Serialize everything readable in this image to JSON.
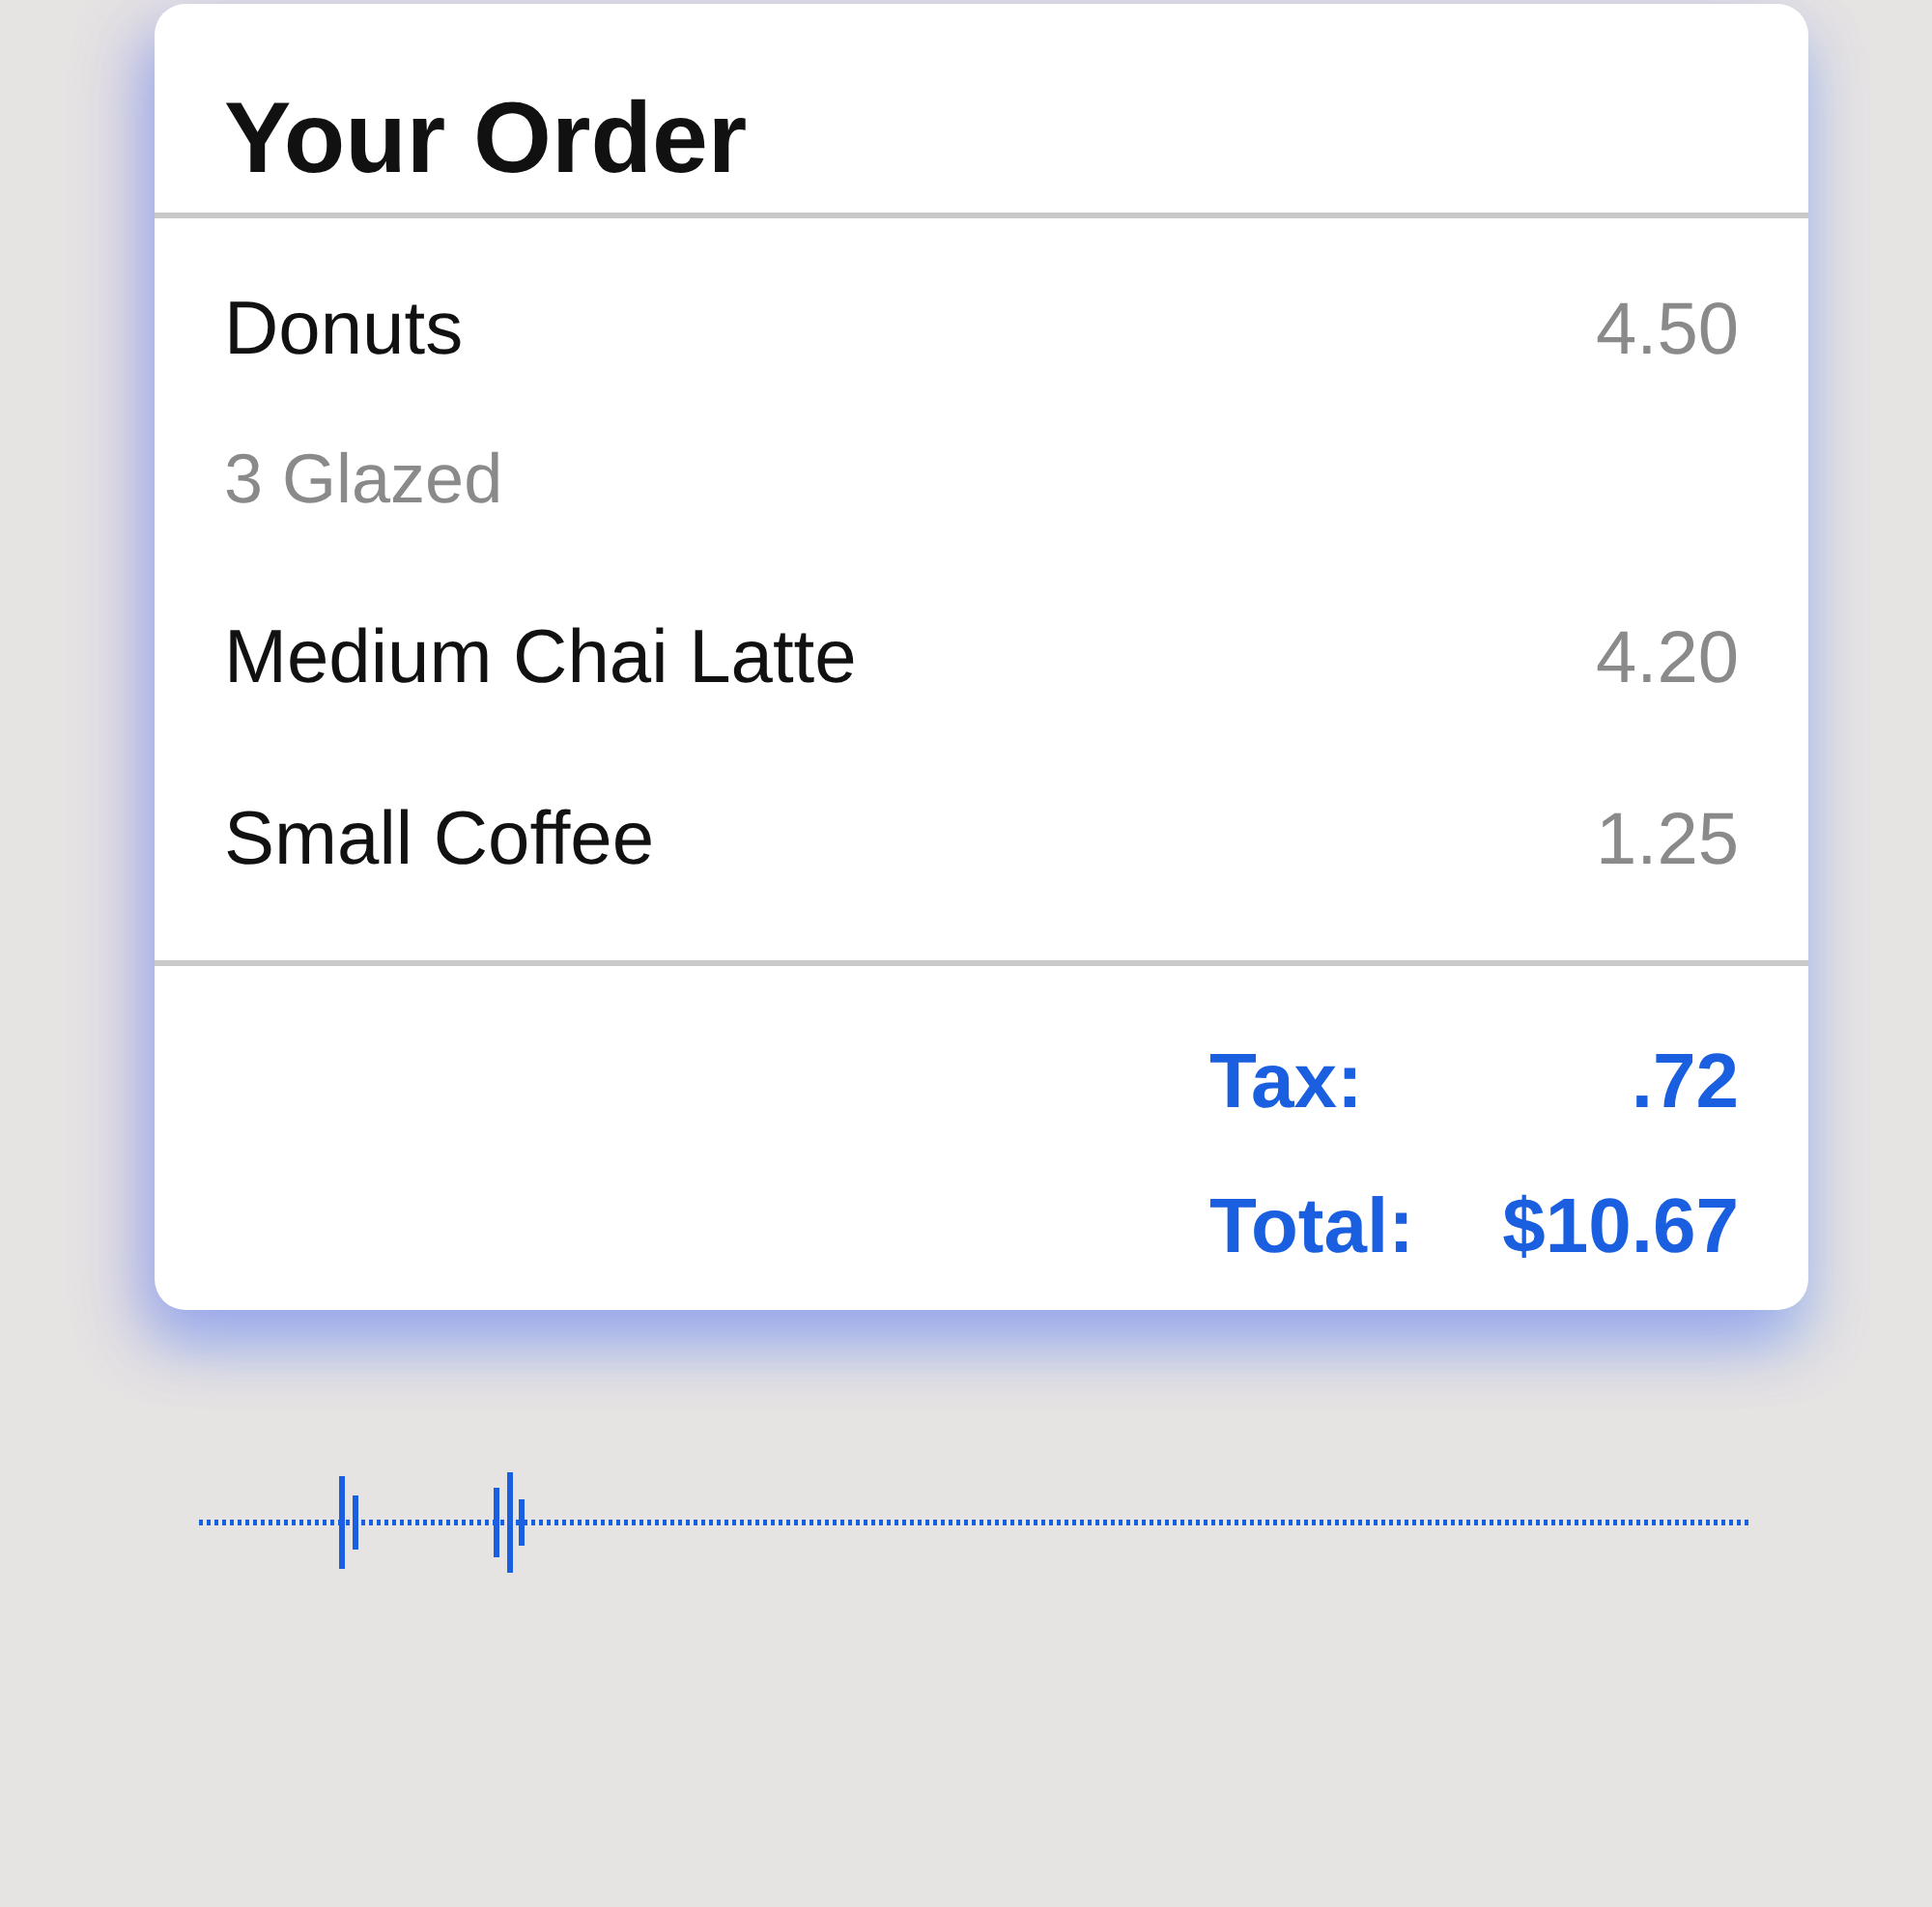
{
  "order": {
    "title": "Your Order",
    "items": [
      {
        "name": "Donuts",
        "detail": "3 Glazed",
        "price": "4.50"
      },
      {
        "name": "Medium Chai Latte",
        "price": "4.20"
      },
      {
        "name": "Small Coffee",
        "price": "1.25"
      }
    ],
    "totals": [
      {
        "label": "Tax:",
        "value": ".72"
      },
      {
        "label": "Total:",
        "value": "$10.67"
      }
    ]
  }
}
